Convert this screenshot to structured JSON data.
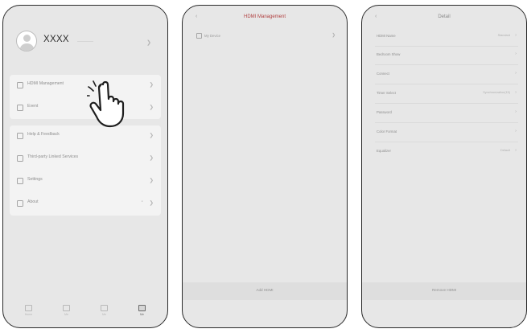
{
  "phone1": {
    "profile": {
      "username": "XXXX"
    },
    "card1": [
      {
        "label": "HDMI Management"
      },
      {
        "label": "Event"
      }
    ],
    "card2": [
      {
        "label": "Help & Feedback"
      },
      {
        "label": "Third-party Linked Services"
      },
      {
        "label": "Settings"
      },
      {
        "label": "About",
        "badge": "·"
      }
    ],
    "tabs": [
      {
        "label": "Home",
        "active": false
      },
      {
        "label": "Me",
        "active": false
      },
      {
        "label": "Me",
        "active": false
      },
      {
        "label": "Me",
        "active": true
      }
    ]
  },
  "phone2": {
    "title": "HDMI Management",
    "device_label": "My Device",
    "add_button": "Add HDMI"
  },
  "phone3": {
    "title": "Detail",
    "rows": [
      {
        "label": "HDMI Name",
        "value": "Standard"
      },
      {
        "label": "Bedroom Show",
        "value": ""
      },
      {
        "label": "Connect",
        "value": ""
      },
      {
        "label": "Timer Select",
        "value": "Synchronization(15)"
      },
      {
        "label": "Password",
        "value": ""
      },
      {
        "label": "Color Format",
        "value": ""
      },
      {
        "label": "Equalizer",
        "value": "Default"
      }
    ],
    "remove_button": "Remove HDMI"
  },
  "colors": {
    "phone_bg": "#e7e7e7",
    "card_bg": "#f3f3f3",
    "title_accent": "#b04040",
    "frame": "#2a2a2a"
  },
  "icons": {
    "back": "chevron-left-icon",
    "row_action": "chevron-right-icon",
    "pointer": "tap-hand-icon"
  }
}
